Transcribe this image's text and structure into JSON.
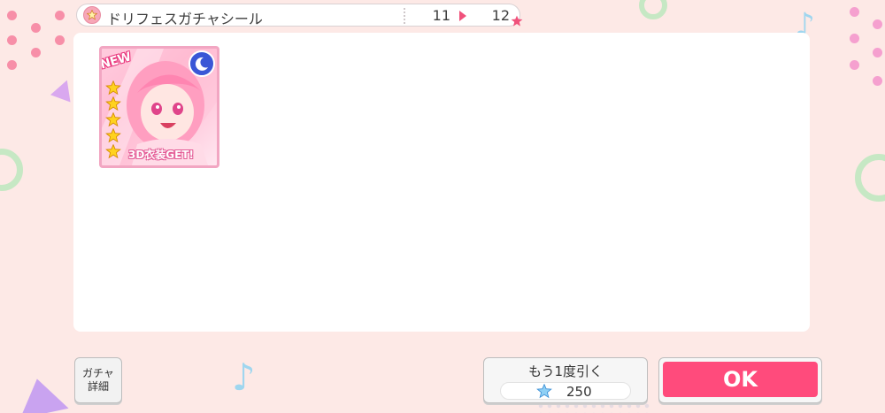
{
  "header": {
    "title": "ドリフェスガチャシール",
    "current": "11",
    "next": "12",
    "accent": "#f0517b"
  },
  "card": {
    "new_badge": "NEW",
    "stars": 5,
    "costume_label": "3D衣装GET!",
    "attribute_icon": "moon-icon"
  },
  "buttons": {
    "detail_label": "ガチャ\n詳細",
    "again_label": "もう1度引く",
    "again_cost": "250",
    "ok_label": "OK"
  },
  "colors": {
    "background": "#fde9e6",
    "ok": "#ff4b7c"
  }
}
